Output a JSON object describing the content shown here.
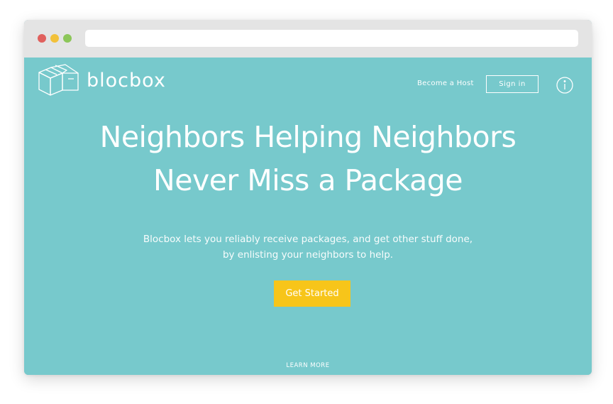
{
  "browser": {
    "url": ""
  },
  "brand": {
    "name": "blocbox"
  },
  "nav": {
    "become_host": "Become a Host",
    "sign_in": "Sign in",
    "info_icon": "info-icon"
  },
  "hero": {
    "title_line1": "Neighbors Helping Neighbors",
    "title_line2": "Never Miss a Package",
    "subtitle_line1": "Blocbox lets you reliably receive packages, and get other stuff done,",
    "subtitle_line2": "by enlisting your neighbors to help.",
    "cta_label": "Get Started"
  },
  "footer": {
    "learn_more": "LEARN MORE",
    "chevron_icon": "chevron-down-icon"
  },
  "colors": {
    "page_background": "#77c9cc",
    "cta_background": "#f7c51a",
    "text": "#ffffff",
    "chrome": "#e4e4e4"
  }
}
